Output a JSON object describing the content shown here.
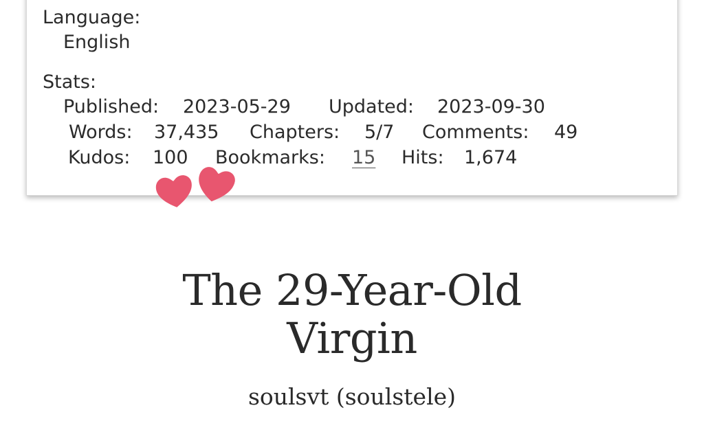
{
  "meta": {
    "language_label": "Language:",
    "language_value": "English",
    "stats_label": "Stats:",
    "stats": {
      "published_label": "Published:",
      "published_value": "2023-05-29",
      "updated_label": "Updated:",
      "updated_value": "2023-09-30",
      "words_label": "Words:",
      "words_value": "37,435",
      "chapters_label": "Chapters:",
      "chapters_value": "5/7",
      "comments_label": "Comments:",
      "comments_value": "49",
      "kudos_label": "Kudos:",
      "kudos_value": "100",
      "bookmarks_label": "Bookmarks:",
      "bookmarks_value": "15",
      "hits_label": "Hits:",
      "hits_value": "1,674"
    }
  },
  "work": {
    "title_line1": "The 29-Year-Old",
    "title_line2": "Virgin",
    "author": "soulsvt (soulstele)"
  },
  "colors": {
    "heart": "#e8566f",
    "text": "#2a2a2a"
  },
  "icons": [
    "heart-icon",
    "heart-icon"
  ]
}
